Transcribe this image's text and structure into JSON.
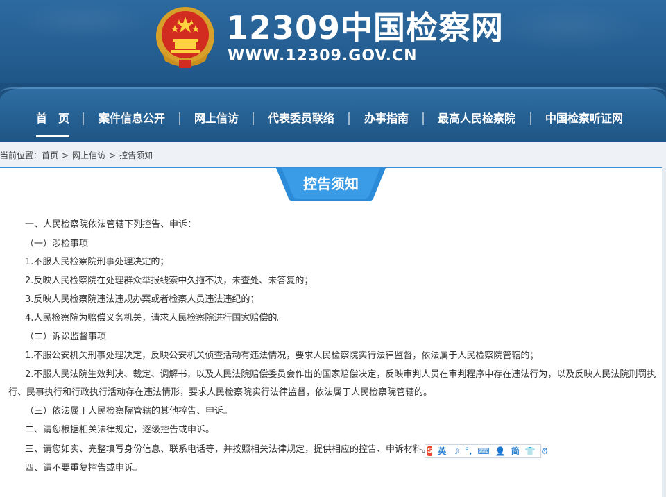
{
  "header": {
    "site_title": "12309中国检察网",
    "site_url": "WWW.12309.GOV.CN"
  },
  "nav": {
    "items": [
      {
        "label": "首　页",
        "active": true
      },
      {
        "label": "案件信息公开"
      },
      {
        "label": "网上信访"
      },
      {
        "label": "代表委员联络"
      },
      {
        "label": "办事指南"
      },
      {
        "label": "最高人民检察院"
      },
      {
        "label": "中国检察听证网"
      }
    ]
  },
  "breadcrumb": {
    "prefix": "当前位置：",
    "items": [
      "首页",
      "网上信访",
      "控告须知"
    ],
    "separator": ">"
  },
  "content": {
    "title": "控告须知",
    "paragraphs": [
      "一、人民检察院依法管辖下列控告、申诉：",
      "（一）涉检事项",
      "1.不服人民检察院刑事处理决定的；",
      "2.反映人民检察院在处理群众举报线索中久拖不决，未查处、未答复的；",
      "3.反映人民检察院违法违规办案或者检察人员违法违纪的；",
      "4.人民检察院为赔偿义务机关，请求人民检察院进行国家赔偿的。",
      "（二）诉讼监督事项",
      "1.不服公安机关刑事处理决定，反映公安机关侦查活动有违法情况，要求人民检察院实行法律监督，依法属于人民检察院管辖的；",
      "2.不服人民法院生效判决、裁定、调解书，以及人民法院赔偿委员会作出的国家赔偿决定，反映审判人员在审判程序中存在违法行为，以及反映人民法院刑罚执",
      "行、民事执行和行政执行活动存在违法情形，要求人民检察院实行法律监督，依法属于人民检察院管辖的。",
      "（三）依法属于人民检察院管辖的其他控告、申诉。",
      "二、请您根据相关法律规定，逐级控告或申诉。",
      "三、请您如实、完整填写身份信息、联系电话等，并按照相关法律规定，提供相应的控告、申诉材料。",
      "四、请不要重复控告或申诉。"
    ]
  },
  "ime_toolbar": {
    "logo": "S",
    "mode": "英",
    "moon": "☽",
    "punct": "°,",
    "keyboard": "⌨",
    "user": "👤",
    "simplified": "简",
    "shirt": "👕",
    "gear": "⚙"
  },
  "colors": {
    "header_bg": "#2d6aa0",
    "nav_bg": "#1e5585",
    "accent": "#3a8fd6",
    "banner": "#2b8bd8"
  }
}
